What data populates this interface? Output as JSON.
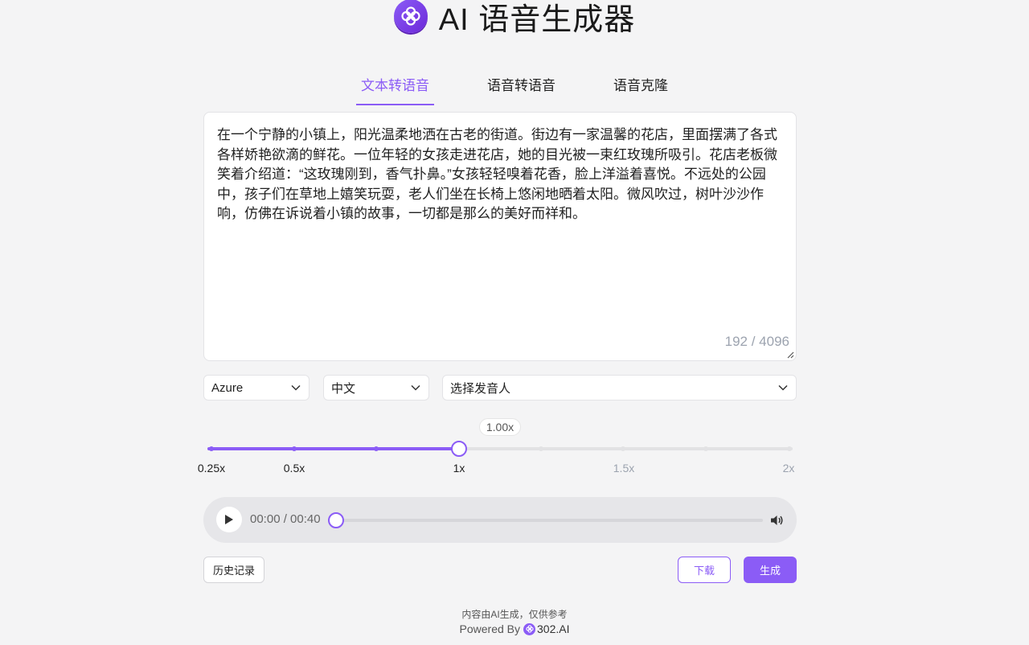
{
  "app": {
    "title": "AI 语音生成器"
  },
  "tabs": [
    {
      "label": "文本转语音",
      "active": true
    },
    {
      "label": "语音转语音",
      "active": false
    },
    {
      "label": "语音克隆",
      "active": false
    }
  ],
  "textarea": {
    "value": "在一个宁静的小镇上，阳光温柔地洒在古老的街道。街边有一家温馨的花店，里面摆满了各式各样娇艳欲滴的鲜花。一位年轻的女孩走进花店，她的目光被一束红玫瑰所吸引。花店老板微笑着介绍道：“这玫瑰刚到，香气扑鼻。”女孩轻轻嗅着花香，脸上洋溢着喜悦。不远处的公园中，孩子们在草地上嬉笑玩耍，老人们坐在长椅上悠闲地晒着太阳。微风吹过，树叶沙沙作响，仿佛在诉说着小镇的故事，一切都是那么的美好而祥和。",
    "counter": "192 / 4096"
  },
  "selects": {
    "provider": "Azure",
    "language": "中文",
    "speaker": "选择发音人"
  },
  "speed": {
    "value_label": "1.00x",
    "value": 1.0,
    "min": 0.25,
    "max": 2,
    "marks": [
      "0.25x",
      "0.5x",
      "1x",
      "1.5x",
      "2x"
    ]
  },
  "player": {
    "time": "00:00 / 00:40",
    "progress": 0
  },
  "actions": {
    "history": "历史记录",
    "download": "下载",
    "generate": "生成"
  },
  "footer": {
    "disclaimer": "内容由AI生成，仅供参考",
    "powered_by": "Powered By",
    "brand": "302.AI"
  },
  "colors": {
    "accent": "#8b5cf6",
    "background": "#f4f4f5"
  }
}
